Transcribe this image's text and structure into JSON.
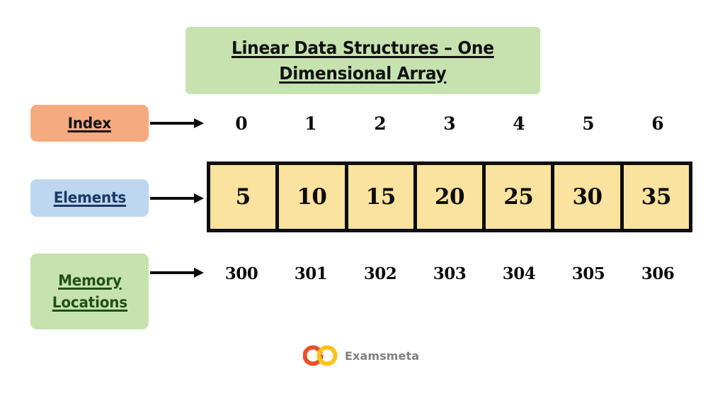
{
  "title": {
    "line1": "Linear Data Structures – One",
    "line2": "Dimensional Array"
  },
  "labels": {
    "index": "Index",
    "elements": "Elements",
    "memory_line1": "Memory",
    "memory_line2": "Locations"
  },
  "array": {
    "indices": [
      "0",
      "1",
      "2",
      "3",
      "4",
      "5",
      "6"
    ],
    "elements": [
      "5",
      "10",
      "15",
      "20",
      "25",
      "30",
      "35"
    ],
    "memory_locations": [
      "300",
      "301",
      "302",
      "303",
      "304",
      "305",
      "306"
    ]
  },
  "colors": {
    "title_box": "#c6e3af",
    "index_chip": "#f5aa80",
    "elements_chip": "#bcd7ef",
    "elements_text": "#1b3864",
    "memory_chip": "#c6e3af",
    "memory_text": "#215015",
    "cell_fill": "#fae29f",
    "cell_border": "#0c0c0c",
    "logo_left": "#e8512b",
    "logo_right": "#fcc21b",
    "logo_text": "#808080"
  },
  "footer": {
    "brand": "Examsmeta",
    "logo_icon": "infinity-logo-icon"
  }
}
